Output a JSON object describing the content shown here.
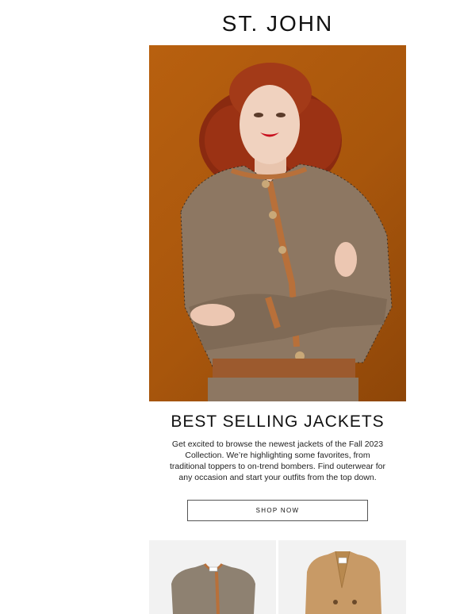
{
  "brand": {
    "logo_text": "ST. JOHN"
  },
  "hero": {
    "image": "model-in-tweed-jacket",
    "background_color": "#a8560c"
  },
  "content": {
    "headline": "BEST SELLING JACKETS",
    "body": "Get excited to browse the newest jackets of the Fall 2023 Collection. We’re highlighting some favorites, from traditional toppers to on-trend bombers. Find outerwear for any occasion and start your outfits from the top down.",
    "cta_label": "SHOP NOW"
  },
  "products": [
    {
      "image": "tweed-jacket-product-image"
    },
    {
      "image": "camel-coat-product-image"
    }
  ],
  "colors": {
    "accent": "#a8560c",
    "tile_bg": "#f2f2f2",
    "text": "#111111"
  }
}
